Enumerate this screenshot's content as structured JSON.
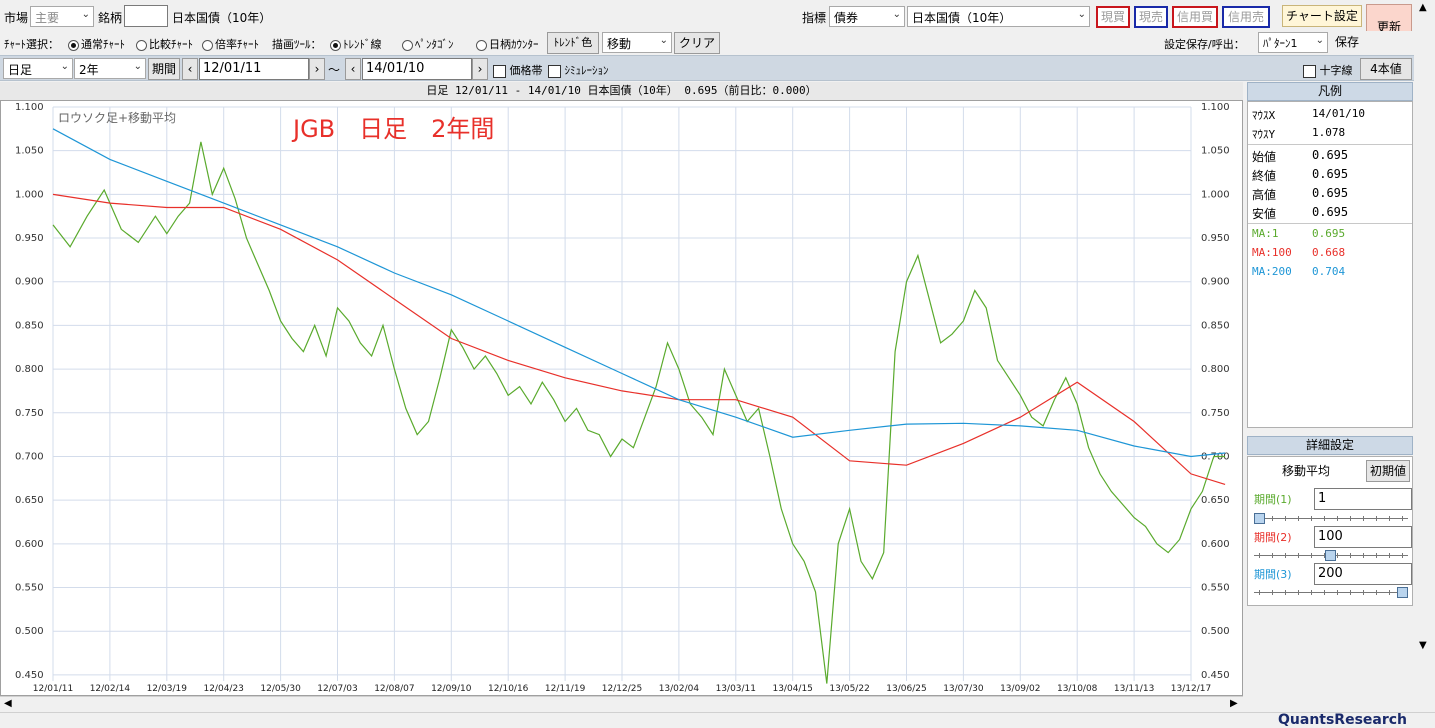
{
  "toolbar1": {
    "market_label": "市場",
    "market_value": "主要",
    "issue_label": "銘柄",
    "issue_value": "",
    "issue_name": "日本国債（10年）",
    "indicator_label": "指標",
    "indicator_value": "債券",
    "indicator_name": "日本国債（10年）",
    "buttons": {
      "spot_buy": "現買",
      "spot_sell": "現売",
      "margin_buy": "信用買",
      "margin_sell": "信用売",
      "chart_settings": "チャート設定",
      "refresh": "更新"
    }
  },
  "toolbar2": {
    "chart_select_label": "ﾁｬｰﾄ選択：",
    "chart_types": [
      "通常ﾁｬｰﾄ",
      "比較ﾁｬｰﾄ",
      "倍率ﾁｬｰﾄ"
    ],
    "draw_tool_label": "描画ﾂｰﾙ：",
    "draw_tools": [
      "ﾄﾚﾝﾄﾞ線",
      "ﾍﾟﾝﾀｺﾞﾝ",
      "日柄ｶｳﾝﾀｰ"
    ],
    "trend_color": "ﾄﾚﾝﾄﾞ色",
    "move_value": "移動",
    "clear": "クリア",
    "save_label": "設定保存/呼出：",
    "pattern_value": "ﾊﾟﾀｰﾝ1",
    "save": "保存"
  },
  "toolbar3": {
    "period_type": "日足",
    "span": "2年",
    "period_btn": "期間",
    "date_from": "12/01/11",
    "tilde": "～",
    "date_to": "14/01/10",
    "price_band": "価格帯",
    "simulation": "ｼﾐｭﾚｰｼｮﾝ",
    "crosshair": "十字線",
    "four_charts": "4本値"
  },
  "chart_header": "日足 12/01/11 - 14/01/10  日本国債（10年）  0.695（前日比：0.000）",
  "chart_subtitle": "ロウソク足+移動平均",
  "chart_annotation": "JGB　日足　2年間",
  "legend": {
    "title": "凡例",
    "mouse_x_label": "ﾏｳｽX",
    "mouse_x": "14/01/10",
    "mouse_y_label": "ﾏｳｽY",
    "mouse_y": "1.078",
    "open_label": "始値",
    "open": "0.695",
    "close_label": "終値",
    "close": "0.695",
    "high_label": "高値",
    "high": "0.695",
    "low_label": "安値",
    "low": "0.695",
    "ma1_label": "MA:1",
    "ma1": "0.695",
    "ma100_label": "MA:100",
    "ma100": "0.668",
    "ma200_label": "MA:200",
    "ma200": "0.704"
  },
  "detail": {
    "title": "詳細設定",
    "tab_ma": "移動平均",
    "tab_init": "初期値",
    "p1_label": "期間(1)",
    "p1": "1",
    "p2_label": "期間(2)",
    "p2": "100",
    "p3_label": "期間(3)",
    "p3": "200"
  },
  "brand": "QuantsResearch",
  "colors": {
    "price": "#5aaa2d",
    "ma100": "#e8302a",
    "ma200": "#1e96d6",
    "annotation": "#e8302a",
    "grid": "#d3dceb"
  },
  "chart_data": {
    "type": "line",
    "title": "JGB　日足　2年間",
    "ylim": [
      0.44,
      1.1
    ],
    "y_ticks": [
      "1.100",
      "1.050",
      "1.000",
      "0.950",
      "0.900",
      "0.850",
      "0.800",
      "0.750",
      "0.700",
      "0.650",
      "0.600",
      "0.550",
      "0.500",
      "0.450"
    ],
    "x_ticks": [
      "12/01/11",
      "12/02/14",
      "12/03/19",
      "12/04/23",
      "12/05/30",
      "12/07/03",
      "12/08/07",
      "12/09/10",
      "12/10/16",
      "12/11/19",
      "12/12/25",
      "13/02/04",
      "13/03/11",
      "13/04/15",
      "13/05/22",
      "13/06/25",
      "13/07/30",
      "13/09/02",
      "13/10/08",
      "13/11/13",
      "13/12/17"
    ],
    "series": [
      {
        "name": "MA:1",
        "color": "#5aaa2d",
        "x": [
          0,
          0.3,
          0.6,
          0.9,
          1.2,
          1.5,
          1.8,
          2.0,
          2.2,
          2.4,
          2.6,
          2.8,
          3.0,
          3.2,
          3.4,
          3.6,
          3.8,
          4.0,
          4.2,
          4.4,
          4.6,
          4.8,
          5.0,
          5.2,
          5.4,
          5.6,
          5.8,
          6.0,
          6.2,
          6.4,
          6.6,
          6.8,
          7.0,
          7.2,
          7.4,
          7.6,
          7.8,
          8.0,
          8.2,
          8.4,
          8.6,
          8.8,
          9.0,
          9.2,
          9.4,
          9.6,
          9.8,
          10.0,
          10.2,
          10.4,
          10.6,
          10.8,
          11.0,
          11.2,
          11.4,
          11.6,
          11.8,
          12.0,
          12.2,
          12.4,
          12.6,
          12.8,
          13.0,
          13.2,
          13.4,
          13.6,
          13.8,
          14.0,
          14.2,
          14.4,
          14.6,
          14.8,
          15.0,
          15.2,
          15.4,
          15.6,
          15.8,
          16.0,
          16.2,
          16.4,
          16.6,
          16.8,
          17.0,
          17.2,
          17.4,
          17.6,
          17.8,
          18.0,
          18.2,
          18.4,
          18.6,
          18.8,
          19.0,
          19.2,
          19.4,
          19.6,
          19.8,
          20.0,
          20.2,
          20.4,
          20.6
        ],
        "values": [
          0.965,
          0.94,
          0.975,
          1.005,
          0.96,
          0.945,
          0.975,
          0.955,
          0.975,
          0.99,
          1.06,
          1.0,
          1.03,
          0.995,
          0.95,
          0.92,
          0.89,
          0.855,
          0.835,
          0.82,
          0.85,
          0.815,
          0.87,
          0.855,
          0.83,
          0.815,
          0.85,
          0.8,
          0.755,
          0.725,
          0.74,
          0.79,
          0.845,
          0.825,
          0.8,
          0.815,
          0.795,
          0.77,
          0.78,
          0.76,
          0.785,
          0.765,
          0.74,
          0.755,
          0.73,
          0.725,
          0.7,
          0.72,
          0.71,
          0.745,
          0.78,
          0.83,
          0.8,
          0.76,
          0.745,
          0.725,
          0.8,
          0.77,
          0.74,
          0.755,
          0.7,
          0.64,
          0.6,
          0.58,
          0.545,
          0.44,
          0.6,
          0.64,
          0.58,
          0.56,
          0.59,
          0.82,
          0.9,
          0.93,
          0.88,
          0.83,
          0.84,
          0.855,
          0.89,
          0.87,
          0.81,
          0.79,
          0.77,
          0.745,
          0.735,
          0.765,
          0.79,
          0.76,
          0.71,
          0.68,
          0.66,
          0.645,
          0.63,
          0.62,
          0.6,
          0.59,
          0.605,
          0.64,
          0.66,
          0.7,
          0.7
        ]
      },
      {
        "name": "MA:100",
        "color": "#e8302a",
        "x": [
          0,
          1,
          2,
          3,
          4,
          5,
          6,
          7,
          8,
          9,
          10,
          11,
          12,
          13,
          14,
          15,
          16,
          17,
          18,
          19,
          20,
          20.6
        ],
        "values": [
          1.0,
          0.99,
          0.985,
          0.985,
          0.96,
          0.925,
          0.88,
          0.835,
          0.81,
          0.79,
          0.775,
          0.765,
          0.765,
          0.745,
          0.695,
          0.69,
          0.715,
          0.745,
          0.785,
          0.74,
          0.68,
          0.668
        ]
      },
      {
        "name": "MA:200",
        "color": "#1e96d6",
        "x": [
          0,
          1,
          2,
          3,
          4,
          5,
          6,
          7,
          8,
          9,
          10,
          11,
          12,
          13,
          14,
          15,
          16,
          17,
          18,
          19,
          20,
          20.6
        ],
        "values": [
          1.075,
          1.04,
          1.015,
          0.99,
          0.965,
          0.94,
          0.91,
          0.885,
          0.855,
          0.825,
          0.795,
          0.765,
          0.745,
          0.722,
          0.73,
          0.737,
          0.738,
          0.735,
          0.73,
          0.712,
          0.7,
          0.704
        ]
      }
    ]
  }
}
